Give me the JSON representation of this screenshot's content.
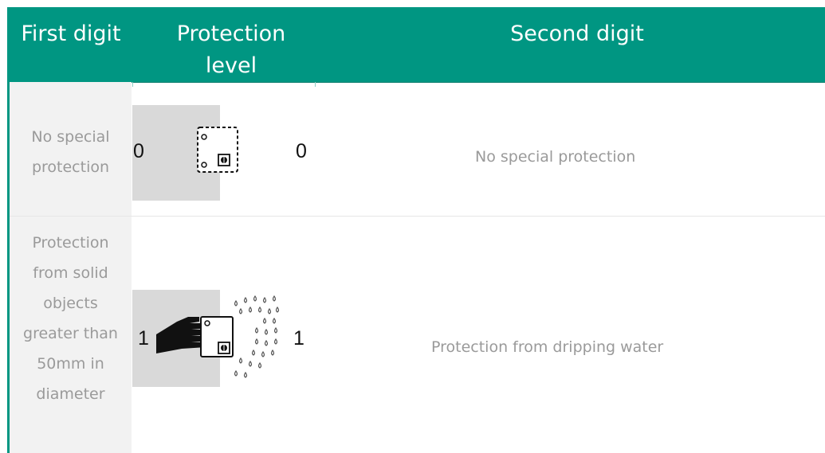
{
  "header": {
    "first_digit": "First digit",
    "protection_level_line1": "Protection",
    "protection_level_line2": "level",
    "second_digit": "Second digit"
  },
  "rows": [
    {
      "first_description": [
        "No special",
        "protection"
      ],
      "first_digit": "0",
      "second_digit": "0",
      "second_description": "No special protection",
      "icon": "dashed-enclosure-icon"
    },
    {
      "first_description": [
        "Protection",
        "from solid",
        "objects",
        "greater than",
        "50mm in",
        "diameter"
      ],
      "first_digit": "1",
      "second_digit": "1",
      "second_description": "Protection from dripping water",
      "icon": "hand-and-drips-icon"
    }
  ],
  "colors": {
    "header": "#009682",
    "first_col_bg": "#f2f2f2",
    "icon_bg": "#d9d9d9",
    "muted_text": "#9a9a9a"
  }
}
